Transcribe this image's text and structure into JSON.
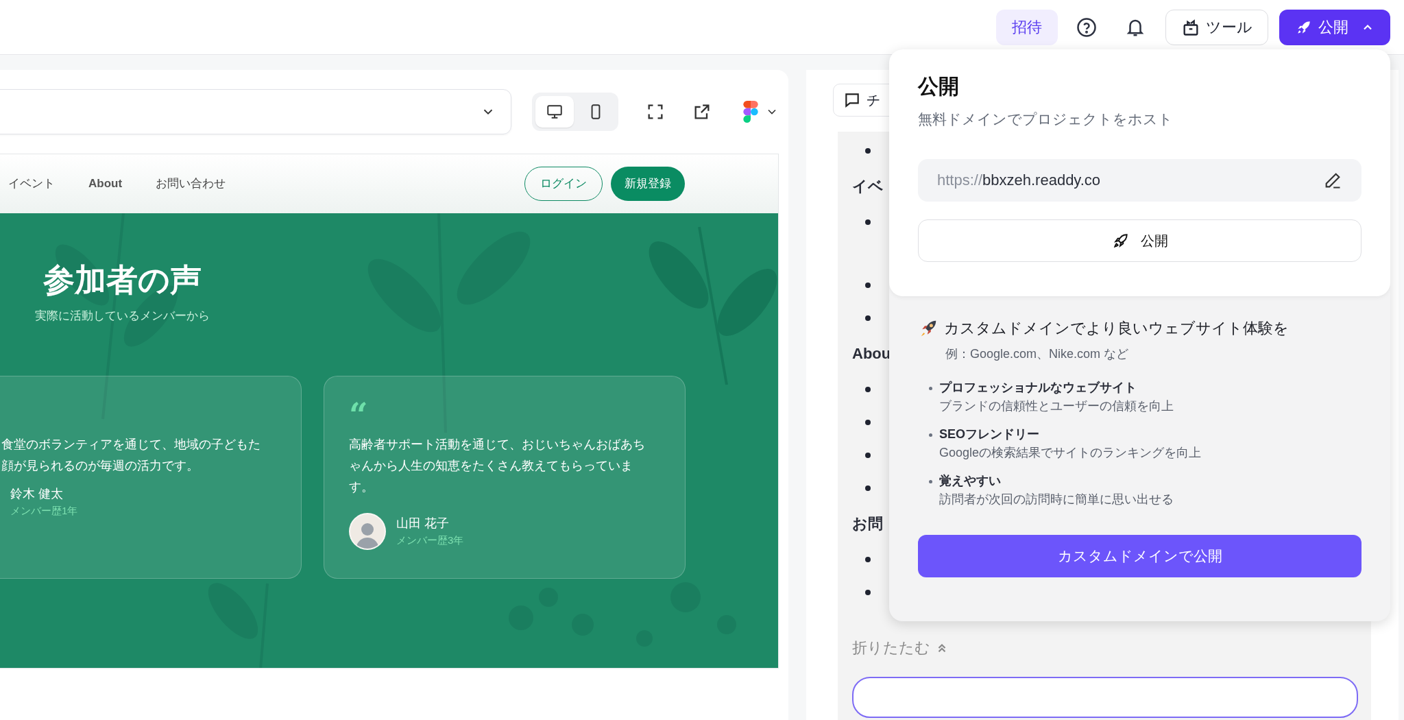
{
  "top_bar": {
    "invite_button": "招待",
    "tools_button": "ツール",
    "publish_button": {
      "label": "公開",
      "expanded": true
    }
  },
  "preview_toolbar": {
    "devices": [
      {
        "kind": "desktop",
        "selected": true
      },
      {
        "kind": "mobile",
        "selected": false
      }
    ]
  },
  "preview": {
    "nav_links": [
      "イベント",
      "About",
      "お問い合わせ"
    ],
    "login_button": "ログイン",
    "signup_button": "新規登録",
    "section_title": "参加者の声",
    "section_subtitle": "実際に活動しているメンバーから",
    "testimonials": [
      {
        "quote_lines": [
          "食堂のボランティアを通じて、地域の子どもた",
          "顔が見られるのが毎週の活力です。"
        ],
        "name": "鈴木 健太",
        "member_since": "メンバー歴1年",
        "avatar": false
      },
      {
        "quote_mark": "“",
        "quote_lines": [
          "高齢者サポート活動を通じて、おじいちゃんおばあち",
          "ゃんから人生の知恵をたくさん教えてもらっていま",
          "す。"
        ],
        "name": "山田 花子",
        "member_since": "メンバー歴3年",
        "avatar": true
      }
    ]
  },
  "chat_panel": {
    "tab_label": "チ",
    "sections": [
      {
        "items": [
          {
            "kind": "bullet"
          }
        ]
      },
      {
        "heading": "イベ",
        "items": [
          {
            "kind": "bullet-wrapped"
          },
          {
            "kind": "bullet"
          },
          {
            "kind": "bullet"
          }
        ]
      },
      {
        "heading": "Abou",
        "items": [
          {
            "kind": "bullet"
          },
          {
            "kind": "bullet"
          },
          {
            "kind": "bullet"
          },
          {
            "kind": "bullet"
          }
        ]
      },
      {
        "heading": "お問",
        "items": [
          {
            "kind": "bullet"
          },
          {
            "kind": "bullet"
          }
        ]
      }
    ],
    "collapse_link": "折りたたむ",
    "input_focused": true
  },
  "publish_popover": {
    "title": "公開",
    "subtitle": "無料ドメインでプロジェクトをホスト",
    "url_prefix": "https://",
    "url_domain": "bbxzeh.readdy.co",
    "publish_button": "公開",
    "promo": {
      "heading": "カスタムドメインでより良いウェブサイト体験を",
      "example": "例：Google.com、Nike.com など",
      "features": [
        {
          "title": "プロフェッショナルなウェブサイト",
          "description": "ブランドの信頼性とユーザーの信頼を向上"
        },
        {
          "title": "SEOフレンドリー",
          "description": "Googleの検索結果でサイトのランキングを向上"
        },
        {
          "title": "覚えやすい",
          "description": "訪問者が次回の訪問時に簡単に思い出せる"
        }
      ],
      "button": "カスタムドメインで公開"
    }
  }
}
